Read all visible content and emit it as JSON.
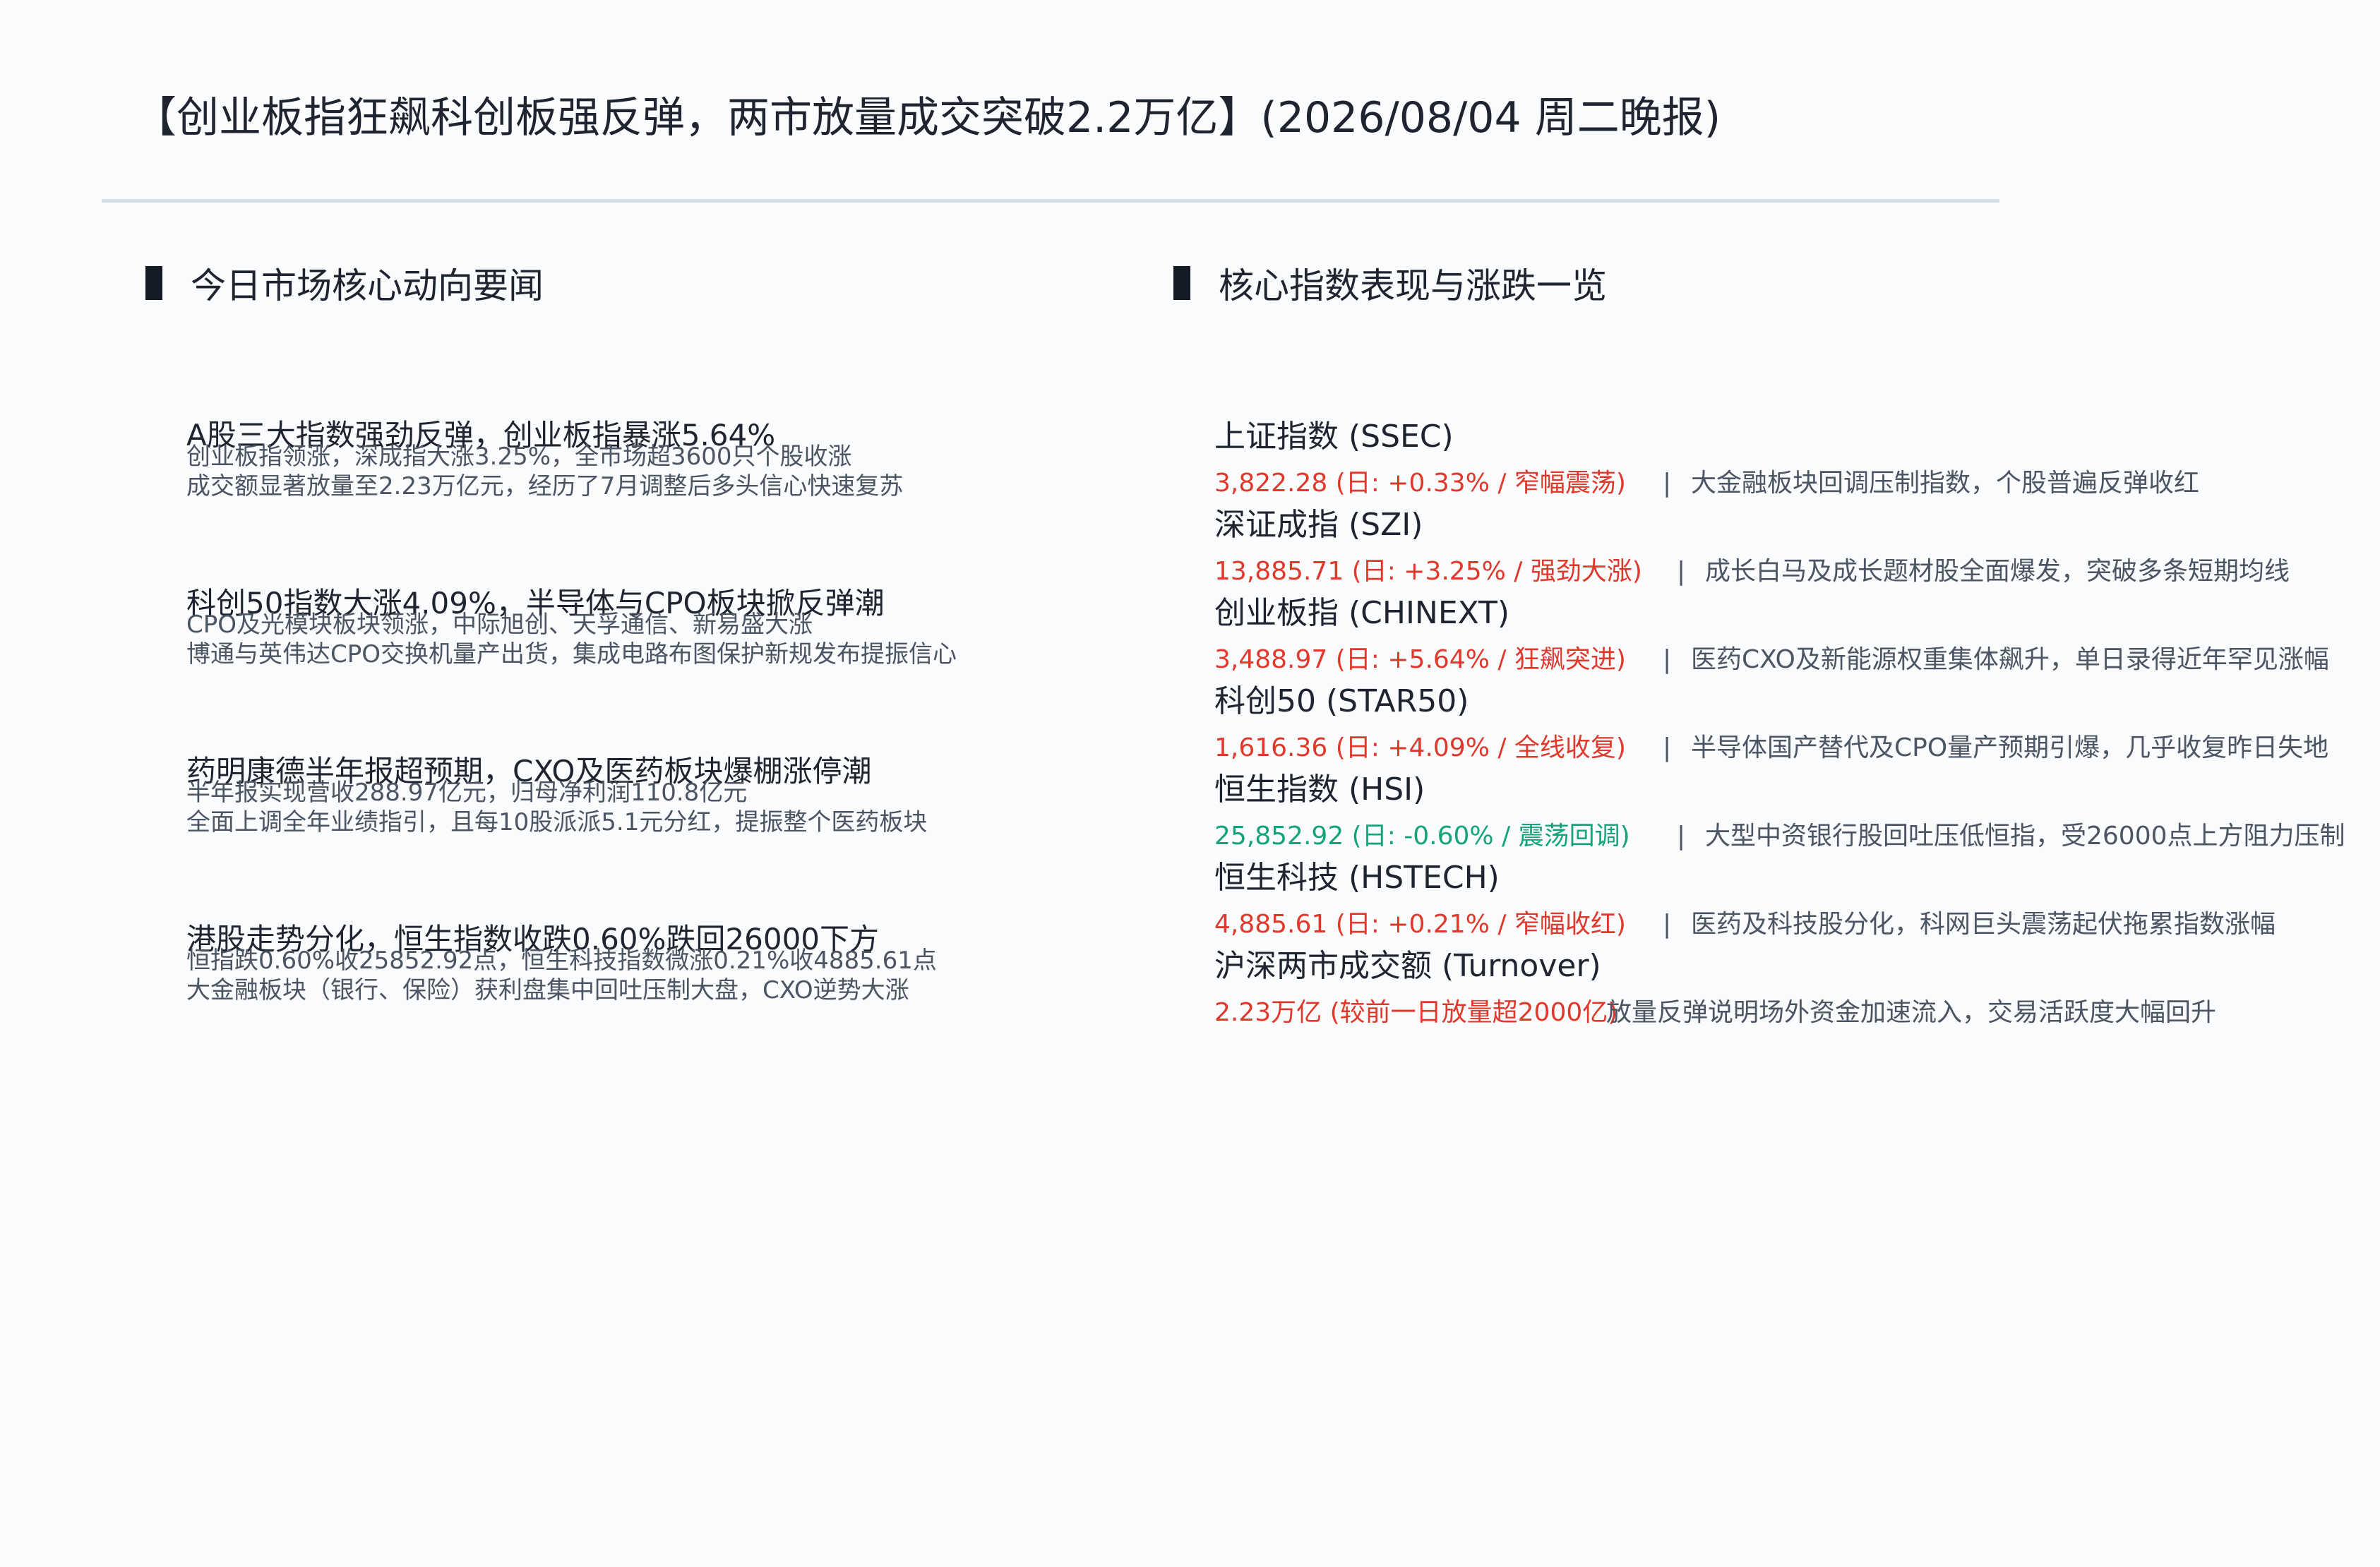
{
  "title": "【创业板指狂飙科创板强反弹，两市放量成交突破2.2万亿】(2026/08/04 周二晚报)",
  "colors": {
    "up": "#e0392b",
    "down": "#14a37a",
    "text_dark": "#1e2430",
    "text_muted": "#4b5563",
    "rule": "#d6dee6"
  },
  "news_section": {
    "heading": "今日市场核心动向要闻",
    "items": [
      {
        "headline": "A股三大指数强劲反弹，创业板指暴涨5.64%",
        "lines": [
          "创业板指领涨，深成指大涨3.25%，全市场超3600只个股收涨",
          "成交额显著放量至2.23万亿元，经历了7月调整后多头信心快速复苏"
        ]
      },
      {
        "headline": "科创50指数大涨4.09%，半导体与CPO板块掀反弹潮",
        "lines": [
          "CPO及光模块板块领涨，中际旭创、天孚通信、新易盛大涨",
          "博通与英伟达CPO交换机量产出货，集成电路布图保护新规发布提振信心"
        ]
      },
      {
        "headline": "药明康德半年报超预期，CXO及医药板块爆棚涨停潮",
        "lines": [
          "半年报实现营收288.97亿元，归母净利润110.8亿元",
          "全面上调全年业绩指引，且每10股派派5.1元分红，提振整个医药板块"
        ]
      },
      {
        "headline": "港股走势分化，恒生指数收跌0.60%跌回26000下方",
        "lines": [
          "恒指跌0.60%收25852.92点，恒生科技指数微涨0.21%收4885.61点",
          "大金融板块（银行、保险）获利盘集中回吐压制大盘，CXO逆势大涨"
        ]
      }
    ]
  },
  "index_section": {
    "heading": "核心指数表现与涨跌一览",
    "separator": "|",
    "items": [
      {
        "name": "上证指数 (SSEC)",
        "value": "3,822.28 (日: +0.33% / 窄幅震荡)",
        "trend": "up",
        "note": "大金融板块回调压制指数，个股普遍反弹收红"
      },
      {
        "name": "深证成指 (SZI)",
        "value": "13,885.71 (日: +3.25% / 强劲大涨)",
        "trend": "up",
        "note": "成长白马及成长题材股全面爆发，突破多条短期均线"
      },
      {
        "name": "创业板指 (CHINEXT)",
        "value": "3,488.97 (日: +5.64% / 狂飙突进)",
        "trend": "up",
        "note": "医药CXO及新能源权重集体飙升，单日录得近年罕见涨幅"
      },
      {
        "name": "科创50 (STAR50)",
        "value": "1,616.36 (日: +4.09% / 全线收复)",
        "trend": "up",
        "note": "半导体国产替代及CPO量产预期引爆，几乎收复昨日失地"
      },
      {
        "name": "恒生指数 (HSI)",
        "value": "25,852.92 (日: -0.60% / 震荡回调)",
        "trend": "down",
        "note": "大型中资银行股回吐压低恒指，受26000点上方阻力压制"
      },
      {
        "name": "恒生科技 (HSTECH)",
        "value": "4,885.61 (日: +0.21% / 窄幅收红)",
        "trend": "up",
        "note": "医药及科技股分化，科网巨头震荡起伏拖累指数涨幅"
      },
      {
        "name": "沪深两市成交额 (Turnover)",
        "value": "2.23万亿 (较前一日放量超2000亿)",
        "trend": "up",
        "note": "放量反弹说明场外资金加速流入，交易活跃度大幅回升",
        "no_separator": true
      }
    ]
  }
}
